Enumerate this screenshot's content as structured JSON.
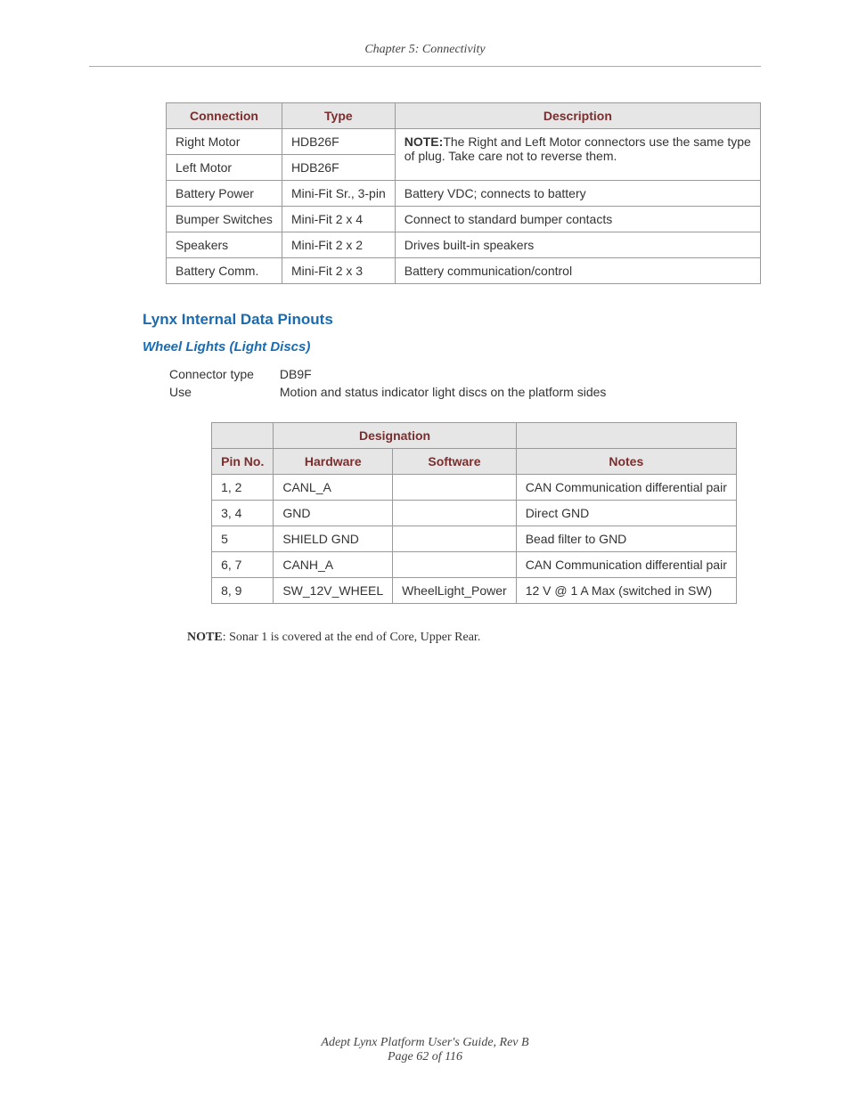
{
  "chapterHeader": "Chapter 5: Connectivity",
  "table1": {
    "headers": {
      "c1": "Connection",
      "c2": "Type",
      "c3": "Description"
    },
    "rows": [
      {
        "c1": "Right Motor",
        "c2": "HDB26F"
      },
      {
        "c1": "Left Motor",
        "c2": "HDB26F"
      }
    ],
    "mergedDesc": {
      "bold": "NOTE:",
      "rest": "The Right and Left Motor connectors use the same type of plug. Take care not to reverse them."
    },
    "rows2": [
      {
        "c1": "Battery Power",
        "c2": "Mini-Fit Sr., 3-pin",
        "c3": "Battery VDC; connects to battery"
      },
      {
        "c1": "Bumper Switches",
        "c2": "Mini-Fit 2 x 4",
        "c3": "Connect to standard bumper contacts"
      },
      {
        "c1": "Speakers",
        "c2": "Mini-Fit 2 x 2",
        "c3": "Drives built-in speakers"
      },
      {
        "c1": "Battery Comm.",
        "c2": "Mini-Fit 2 x 3",
        "c3": "Battery communication/control"
      }
    ]
  },
  "sectionTitle": "Lynx Internal Data Pinouts",
  "subsectionTitle": "Wheel Lights (Light Discs)",
  "kv": [
    {
      "k": "Connector type",
      "v": "DB9F"
    },
    {
      "k": "Use",
      "v": "Motion and status indicator light discs on the platform sides"
    }
  ],
  "table2": {
    "designation": "Designation",
    "headers": {
      "pin": "Pin No.",
      "hw": "Hardware",
      "sw": "Software",
      "notes": "Notes"
    },
    "rows": [
      {
        "pin": "1, 2",
        "hw": "CANL_A",
        "sw": "",
        "notes": "CAN Communication differential pair"
      },
      {
        "pin": "3, 4",
        "hw": "GND",
        "sw": "",
        "notes": "Direct GND"
      },
      {
        "pin": "5",
        "hw": "SHIELD GND",
        "sw": "",
        "notes": "Bead filter to GND"
      },
      {
        "pin": "6, 7",
        "hw": "CANH_A",
        "sw": "",
        "notes": "CAN Communication differential pair"
      },
      {
        "pin": "8, 9",
        "hw": "SW_12V_WHEEL",
        "sw": "WheelLight_Power",
        "notes": "12 V @ 1 A Max (switched in SW)"
      }
    ]
  },
  "note": {
    "bold": "NOTE",
    "rest": ": Sonar 1 is covered at the end of Core, Upper Rear."
  },
  "footer": {
    "line1": "Adept Lynx Platform User's Guide, Rev B",
    "line2": "Page 62 of 116"
  }
}
